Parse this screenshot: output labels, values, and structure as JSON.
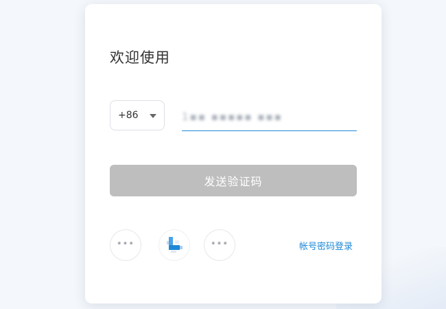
{
  "login": {
    "title": "欢迎使用",
    "country_code": "+86",
    "phone_value": "1▪▪ ▪▪▪▪▪ ▪▪▪",
    "send_code_label": "发送验证码",
    "password_login_label": "帐号密码登录"
  },
  "social_logins": [
    {
      "icon": "more-icon",
      "text": "•••"
    },
    {
      "icon": "brand-logo-icon"
    },
    {
      "icon": "more-icon",
      "text": "•••"
    }
  ],
  "colors": {
    "accent": "#1e88d6",
    "button_disabled": "#bebebe",
    "title_text": "#333333"
  }
}
